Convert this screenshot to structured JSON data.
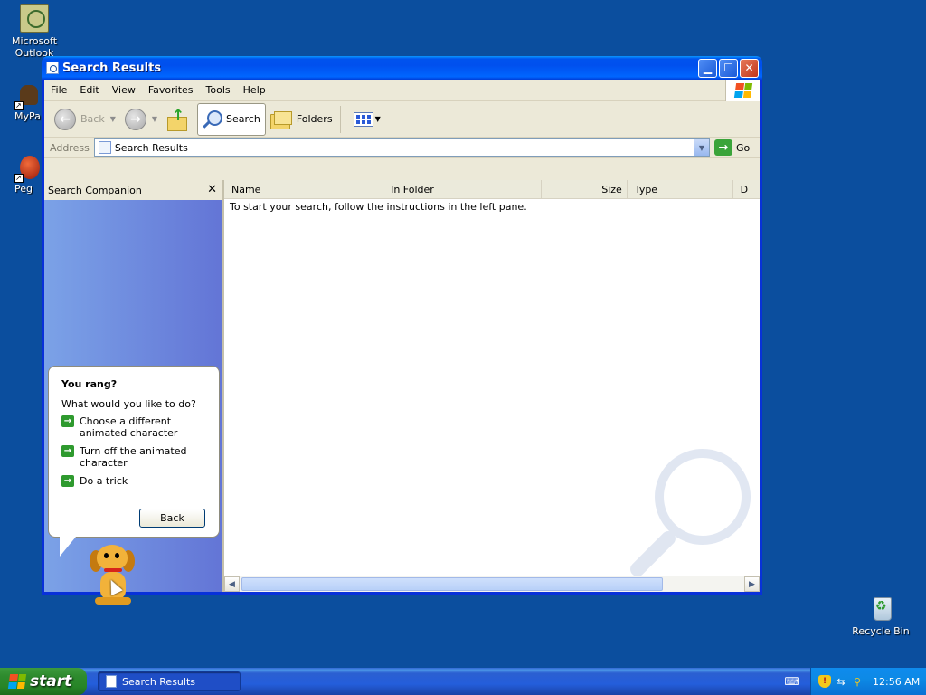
{
  "desktop": {
    "icons": [
      {
        "label": "Microsoft Outlook",
        "icon": "outlook-icon"
      },
      {
        "label": "MyPa",
        "icon": "mypa-icon"
      },
      {
        "label": "Peg",
        "icon": "peg-icon"
      },
      {
        "label": "Recycle Bin",
        "icon": "recycle-bin-icon"
      }
    ]
  },
  "window": {
    "title": "Search Results",
    "menu": [
      "File",
      "Edit",
      "View",
      "Favorites",
      "Tools",
      "Help"
    ],
    "toolbar": {
      "back": "Back",
      "search": "Search",
      "folders": "Folders"
    },
    "address": {
      "label": "Address",
      "value": "Search Results",
      "go": "Go"
    },
    "search_companion": {
      "title": "Search Companion",
      "close": "✕"
    },
    "balloon": {
      "title": "You rang?",
      "question": "What would you like to do?",
      "options": [
        "Choose a different animated character",
        "Turn off the animated character",
        "Do a trick"
      ],
      "back_button": "Back"
    },
    "columns": [
      "Name",
      "In Folder",
      "Size",
      "Type",
      "D"
    ],
    "message": "To start your search, follow the instructions in the left pane."
  },
  "taskbar": {
    "start": "start",
    "task": "Search Results",
    "clock": "12:56 AM"
  },
  "colors": {
    "desktop": "#0b4e9e",
    "titlebar": "#0053ee",
    "left_pane": "#7ba2e7",
    "start_button": "#2e8b2e"
  }
}
